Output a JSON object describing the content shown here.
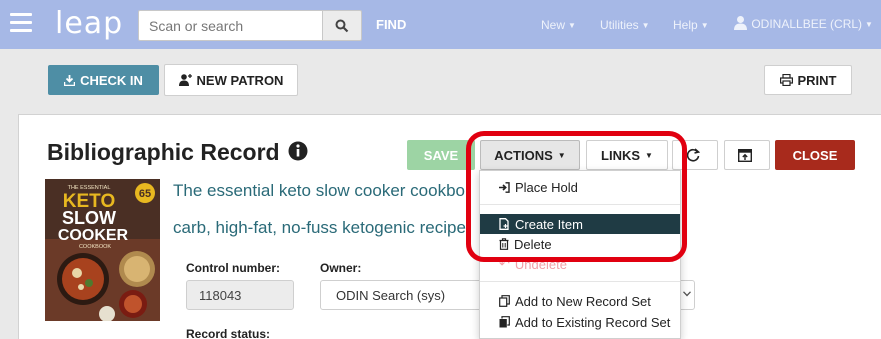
{
  "nav": {
    "logo": "leap",
    "search_placeholder": "Scan or search",
    "find": "FIND",
    "new": "New",
    "utilities": "Utilities",
    "help": "Help",
    "user": "ODINALLBEE (CRL)"
  },
  "toolbar": {
    "checkin": "CHECK IN",
    "new_patron": "NEW PATRON",
    "print": "PRINT"
  },
  "record": {
    "title": "Bibliographic Record",
    "save": "SAVE",
    "actions": "ACTIONS",
    "links": "LINKS",
    "close": "CLOSE",
    "book_line1": "The essential keto slow cooker cookbo",
    "book_line2": "carb, high-fat, no-fuss ketogenic recipe",
    "control_label": "Control number:",
    "control_value": "118043",
    "owner_label": "Owner:",
    "owner_value": "ODIN Search (sys)",
    "status_label": "Record status:"
  },
  "cover": {
    "line1": "THE ESSENTIAL",
    "line2": "KETO",
    "line3": "SLOW",
    "line4": "COOKER",
    "line5": "COOKBOOK",
    "badge": "65"
  },
  "actions_menu": {
    "place_hold": "Place Hold",
    "create_item": "Create Item",
    "delete": "Delete",
    "undelete": "Undelete",
    "add_new_set": "Add to New Record Set",
    "add_existing_set": "Add to Existing Record Set"
  },
  "colors": {
    "nav_bg": "#a6b8e6",
    "checkin_bg": "#4e8ea5",
    "save_bg": "#9dd4a4",
    "close_bg": "#a82a1c",
    "menu_active": "#1f3b44",
    "highlight": "#e10010",
    "link_text": "#2a6a78"
  }
}
